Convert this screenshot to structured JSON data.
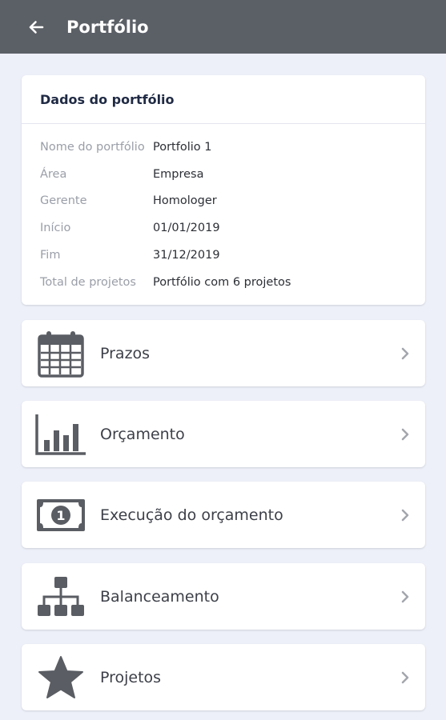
{
  "appbar": {
    "title": "Portfólio",
    "back_icon": "arrow-left-icon"
  },
  "info": {
    "header": "Dados do portfólio",
    "rows": [
      {
        "label": "Nome do portfólio",
        "value": "Portfolio 1"
      },
      {
        "label": "Área",
        "value": "Empresa"
      },
      {
        "label": "Gerente",
        "value": "Homologer"
      },
      {
        "label": "Início",
        "value": "01/01/2019"
      },
      {
        "label": "Fim",
        "value": "31/12/2019"
      },
      {
        "label": "Total de projetos",
        "value": "Portfólio com 6 projetos"
      }
    ]
  },
  "menu": [
    {
      "label": "Prazos",
      "icon": "calendar-icon"
    },
    {
      "label": "Orçamento",
      "icon": "bar-chart-icon"
    },
    {
      "label": "Execução do orçamento",
      "icon": "money-bill-icon"
    },
    {
      "label": "Balanceamento",
      "icon": "hierarchy-icon"
    },
    {
      "label": "Projetos",
      "icon": "star-icon"
    }
  ],
  "colors": {
    "appbar": "#5b5f66",
    "background": "#eef0f9",
    "icon": "#5a5d63"
  }
}
